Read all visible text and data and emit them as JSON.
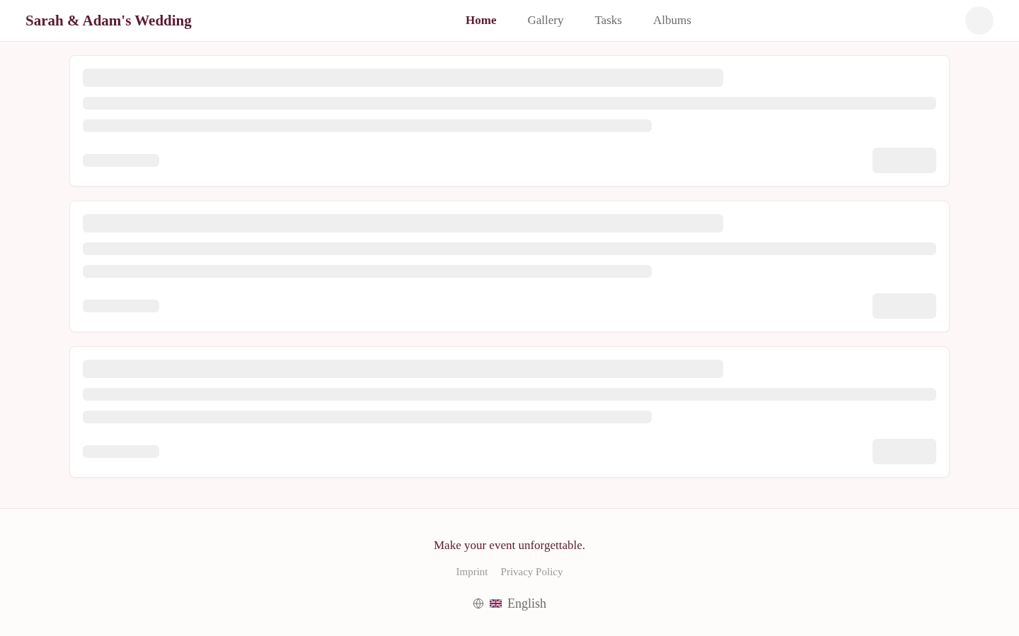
{
  "header": {
    "title": "Sarah & Adam's Wedding",
    "nav": [
      {
        "label": "Home",
        "selected": true
      },
      {
        "label": "Gallery",
        "selected": false
      },
      {
        "label": "Tasks",
        "selected": false
      },
      {
        "label": "Albums",
        "selected": false
      }
    ]
  },
  "main": {
    "loading": true
  },
  "footer": {
    "tagline": "Make your event unforgettable.",
    "links": [
      "Imprint",
      "Privacy Policy"
    ],
    "language": "English"
  }
}
